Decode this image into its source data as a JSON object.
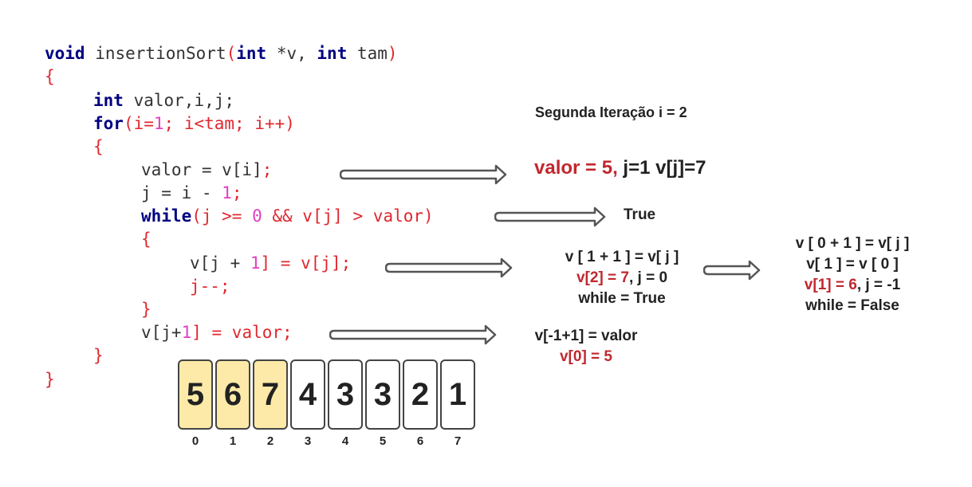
{
  "code": {
    "l1_void": "void",
    "l1_fn": " insertionSort",
    "l1_paren": "(",
    "l1_int1": "int",
    "l1_v": " *v, ",
    "l1_int2": "int",
    "l1_tam": " tam",
    "l1_close": ")",
    "l2": "{",
    "l3_int": "int",
    "l3_rest": " valor,i,j;",
    "l4_for": "for",
    "l4_a": "(i=",
    "l4_one": "1",
    "l4_b": "; i<tam; i++)",
    "l5": "{",
    "l6_a": "valor = v[i]",
    "l6_b": ";",
    "l7_a": "j = i - ",
    "l7_one": "1",
    "l7_b": ";",
    "l8_while": "while",
    "l8_rest": "(j >= ",
    "l8_zero": "0",
    "l8_rest2": " && v[j] > valor)",
    "l9": "{",
    "l10_a": "v[j + ",
    "l10_one": "1",
    "l10_b": "] = v[j];",
    "l11": "j--;",
    "l12": "}",
    "l13_a": "v[j+",
    "l13_one": "1",
    "l13_b": "] = valor;",
    "l14": "}",
    "l15": "}"
  },
  "annotations": {
    "title": "Segunda Iteração i = 2",
    "valor_red": "valor = 5,",
    "valor_black": " j=1 v[j]=7",
    "while_result": "True",
    "step1_line1": "v [ 1 + 1 ] = v[ j ]",
    "step1_line2_red": "v[2] = 7",
    "step1_line2_black": ", j = 0",
    "step1_line3": "while = True",
    "step2_line1": "v [ 0 + 1 ] = v[ j ]",
    "step2_line2": "v[ 1 ] = v [ 0 ]",
    "step2_line3_red": "v[1] = 6",
    "step2_line3_black": ", j = -1",
    "step2_line4": "while = False",
    "final_line1": "v[-1+1] = valor",
    "final_line2_red": "v[0] = 5"
  },
  "array": {
    "values": [
      "5",
      "6",
      "7",
      "4",
      "3",
      "3",
      "2",
      "1"
    ],
    "indices": [
      "0",
      "1",
      "2",
      "3",
      "4",
      "5",
      "6",
      "7"
    ],
    "highlighted": [
      true,
      true,
      true,
      false,
      false,
      false,
      false,
      false
    ],
    "highlight_color": "#fdeaa8"
  },
  "colors": {
    "keyword": "#000080",
    "literal": "#e0282f",
    "number": "#e040c0",
    "annotation_red": "#c0282e"
  }
}
